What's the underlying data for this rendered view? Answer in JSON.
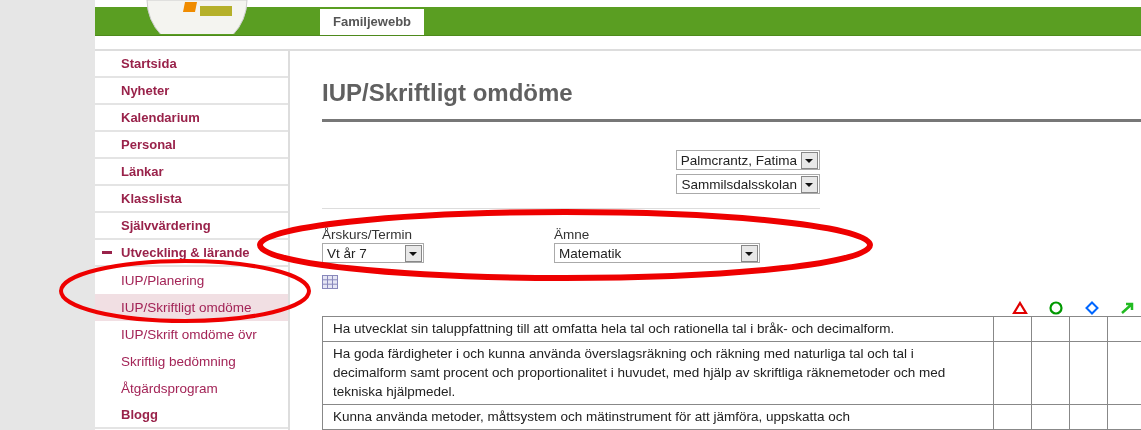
{
  "header": {
    "tabs": [
      {
        "label": "Familjewebb",
        "selected": true
      }
    ]
  },
  "sidebar": {
    "items": [
      {
        "label": "Startsida",
        "selected": false
      },
      {
        "label": "Nyheter",
        "selected": false
      },
      {
        "label": "Kalendarium",
        "selected": false
      },
      {
        "label": "Personal",
        "selected": false
      },
      {
        "label": "Länkar",
        "selected": false
      },
      {
        "label": "Klasslista",
        "selected": false
      },
      {
        "label": "Självvärdering",
        "selected": false
      },
      {
        "label": "Utveckling & lärande",
        "selected": false,
        "expanded": true,
        "children": [
          {
            "label": "IUP/Planering",
            "selected": false
          },
          {
            "label": "IUP/Skriftligt omdöme",
            "selected": true
          },
          {
            "label": "IUP/Skrift omdöme övr",
            "selected": false
          },
          {
            "label": "Skriftlig bedömning",
            "selected": false
          },
          {
            "label": "Åtgärdsprogram",
            "selected": false
          }
        ]
      },
      {
        "label": "Blogg",
        "selected": false
      }
    ]
  },
  "page": {
    "title": "IUP/Skriftligt omdöme",
    "student_select": {
      "value": "Palmcrantz, Fatima"
    },
    "school_select": {
      "value": "Sammilsdalsskolan"
    },
    "filters": [
      {
        "label": "Årskurs/Termin",
        "value": "Vt år 7",
        "kind": "short"
      },
      {
        "label": "Ämne",
        "value": "Matematik",
        "kind": "wide"
      }
    ],
    "table": {
      "columns": [
        {
          "kind": "triangle",
          "color": "#e00000"
        },
        {
          "kind": "circle",
          "color": "#009900"
        },
        {
          "kind": "diamond",
          "color": "#0066ff"
        },
        {
          "kind": "arrow",
          "color": "#22bb22"
        }
      ],
      "rows": [
        "Ha utvecklat sin taluppfattning till att omfatta hela tal och rationella tal i bråk- och decimalform.",
        "Ha goda färdigheter i och kunna använda överslagsräkning och räkning med naturliga tal och tal i decimalform samt procent och proportionalitet i huvudet, med hjälp av skriftliga räknemetoder och med tekniska hjälpmedel.",
        "Kunna använda metoder, måttsystem och mätinstrument för att jämföra, uppskatta och"
      ]
    }
  }
}
